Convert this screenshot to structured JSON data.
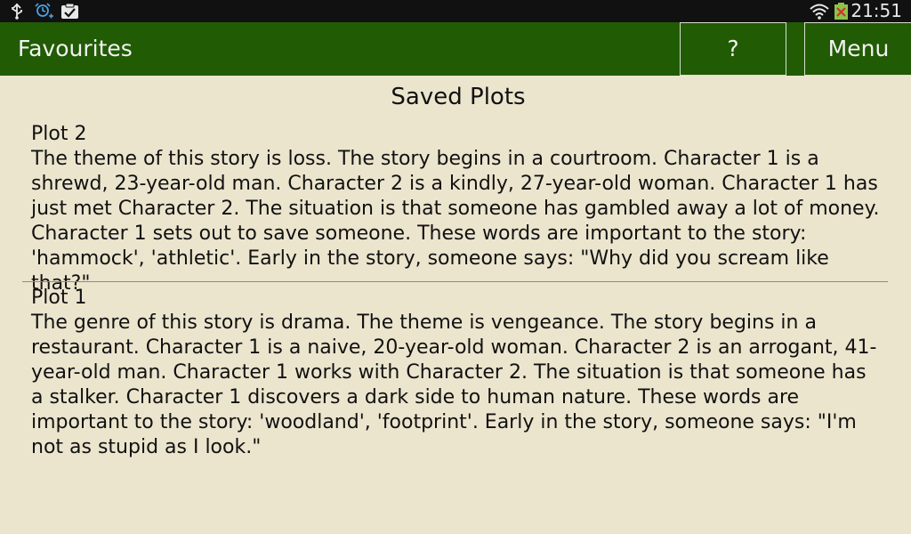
{
  "status_bar": {
    "time": "21:51",
    "icons": [
      "usb-icon",
      "alarm-icon",
      "clipboard-check-icon",
      "wifi-icon",
      "battery-icon"
    ]
  },
  "action_bar": {
    "title": "Favourites",
    "help_label": "?",
    "menu_label": "Menu"
  },
  "main": {
    "title": "Saved Plots",
    "plots": [
      {
        "label": "Plot 2",
        "text": "The theme of this story is loss. The story begins in a courtroom. Character 1 is  a shrewd, 23-year-old man. Character 2 is  a kindly, 27-year-old woman. Character 1 has just met Character 2. The situation is that someone has gambled away a lot of money. Character 1 sets out to save someone. These words are important to the story: 'hammock', 'athletic'. Early in the story, someone says: \"Why did you scream like that?\""
      },
      {
        "label": "Plot 1",
        "text": "The genre of this story is drama. The theme is vengeance. The story begins in a restaurant. Character 1 is a naive, 20-year-old woman. Character 2 is an arrogant, 41-year-old man. Character 1 works with Character 2. The situation is that someone has a stalker. Character 1 discovers a dark side to human nature. These words are important to the story:  'woodland', 'footprint'. Early in the story, someone says: \"I'm not as stupid as I look.\""
      }
    ]
  },
  "colors": {
    "action_bar": "#215b04",
    "background": "#ece5ce",
    "status_bar": "#111111"
  }
}
